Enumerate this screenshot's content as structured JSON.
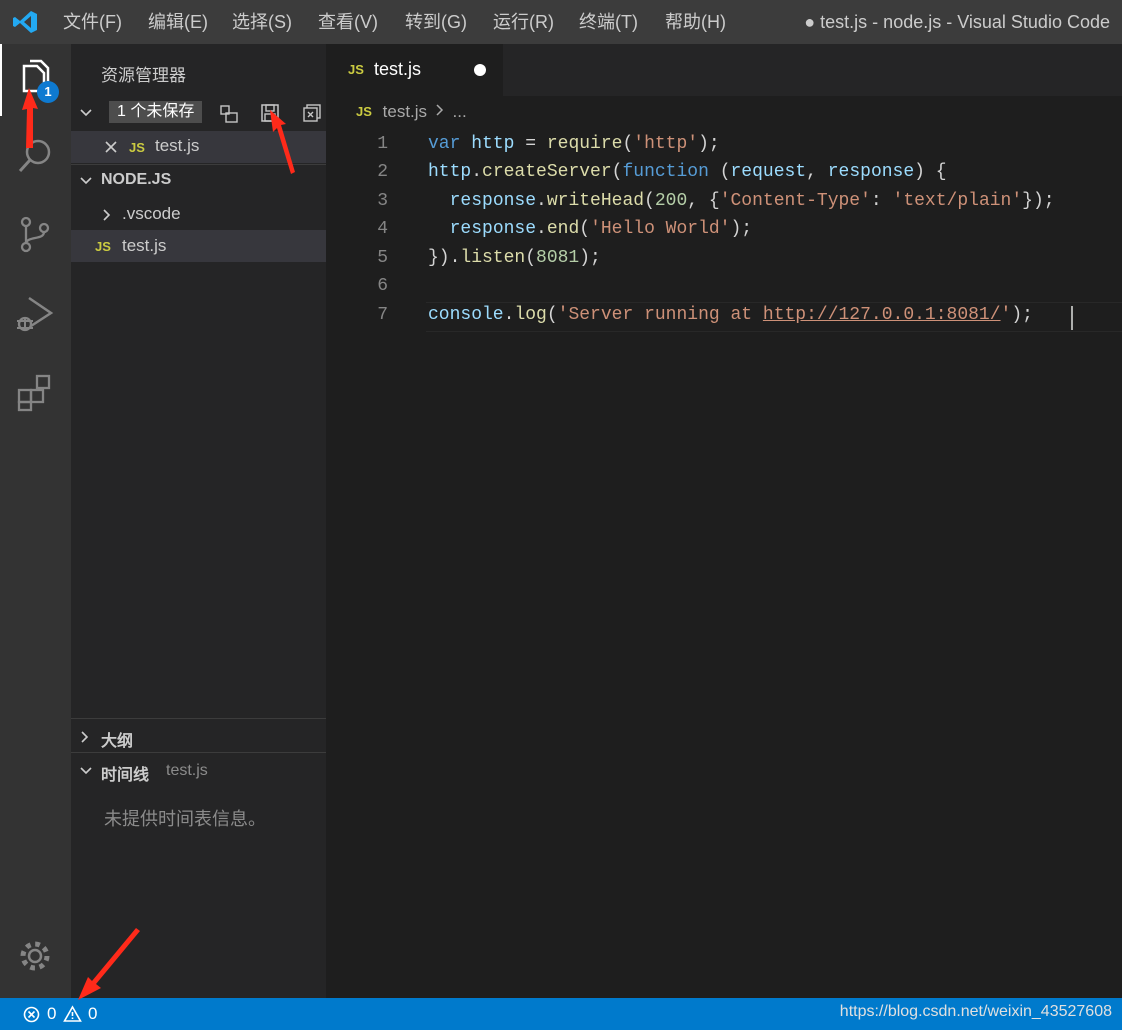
{
  "titlebar": {
    "menu": [
      "文件(F)",
      "编辑(E)",
      "选择(S)",
      "查看(V)",
      "转到(G)",
      "运行(R)",
      "终端(T)",
      "帮助(H)"
    ],
    "window_title": "● test.js - node.js - Visual Studio Code"
  },
  "activitybar": {
    "items": [
      "explorer-icon",
      "search-icon",
      "source-control-icon",
      "run-debug-icon",
      "extensions-icon"
    ],
    "explorer_badge": "1",
    "settings_icon": "gear-icon"
  },
  "sidebar": {
    "title": "资源管理器",
    "open_editors": {
      "badge": "1 个未保存",
      "items": [
        {
          "tag": "JS",
          "name": "test.js"
        }
      ]
    },
    "folder": {
      "name": "NODE.JS",
      "items": [
        {
          "type": "folder",
          "name": ".vscode"
        },
        {
          "type": "file",
          "tag": "JS",
          "name": "test.js"
        }
      ]
    },
    "outline": {
      "title": "大纲"
    },
    "timeline": {
      "title": "时间线",
      "file": "test.js",
      "empty": "未提供时间表信息。"
    }
  },
  "editor": {
    "tab": {
      "tag": "JS",
      "label": "test.js"
    },
    "breadcrumb": {
      "tag": "JS",
      "file": "test.js",
      "rest": "..."
    },
    "line_numbers": [
      "1",
      "2",
      "3",
      "4",
      "5",
      "6",
      "7"
    ],
    "code": [
      "var http = require('http');",
      "http.createServer(function (request, response) {",
      "  response.writeHead(200, {'Content-Type': 'text/plain'});",
      "  response.end('Hello World');",
      "}).listen(8081);",
      "",
      "console.log('Server running at http://127.0.0.1:8081/');"
    ]
  },
  "statusbar": {
    "errors": "0",
    "warnings": "0",
    "watermark": "https://blog.csdn.net/weixin_43527608"
  },
  "colors": {
    "accent": "#007acc",
    "badge": "#0e7ad1",
    "annotation": "#ff2a1a"
  }
}
